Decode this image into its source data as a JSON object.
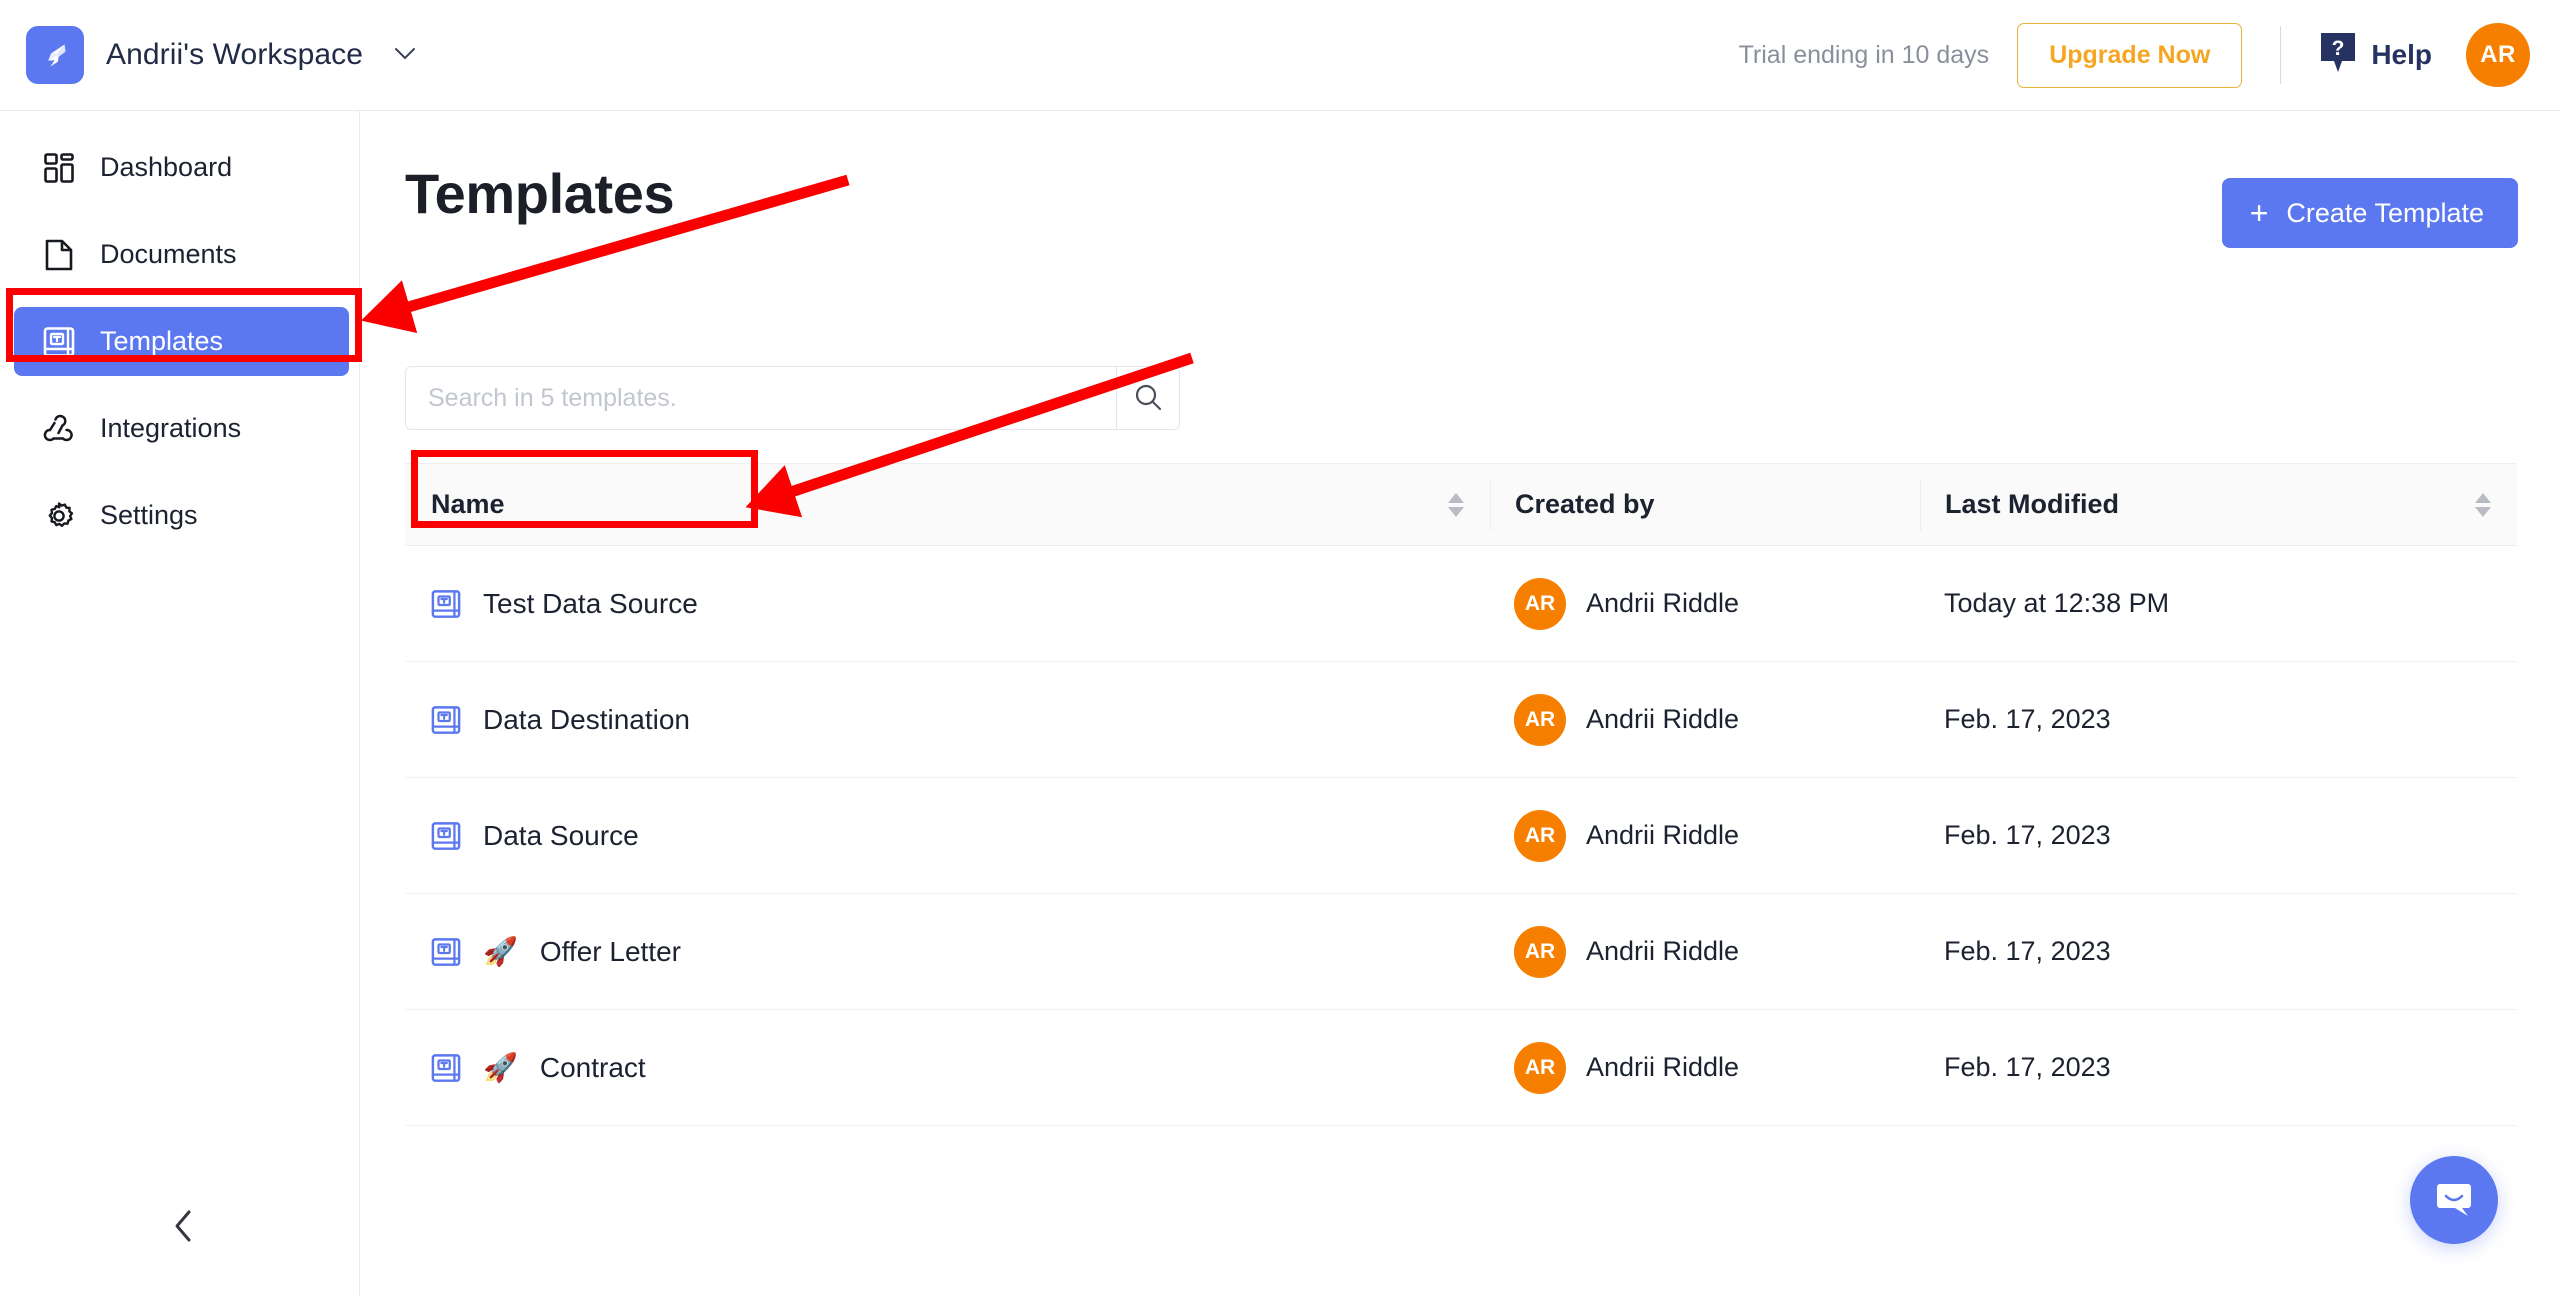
{
  "topbar": {
    "logo_icon": "bird-logo-icon",
    "workspace_name": "Andrii's Workspace",
    "workspace_caret": "⌄",
    "trial_text": "Trial ending in 10 days",
    "upgrade_label": "Upgrade Now",
    "help_icon": "help-question-bubble-icon",
    "help_label": "Help",
    "avatar_initials": "AR"
  },
  "sidebar": {
    "items": [
      {
        "label": "Dashboard",
        "icon": "dashboard-grid-icon",
        "active": false
      },
      {
        "label": "Documents",
        "icon": "document-page-icon",
        "active": false
      },
      {
        "label": "Templates",
        "icon": "template-book-icon",
        "active": true
      },
      {
        "label": "Integrations",
        "icon": "integrations-webhook-icon",
        "active": false
      },
      {
        "label": "Settings",
        "icon": "gear-icon",
        "active": false
      }
    ],
    "collapse_icon": "chevron-left-icon"
  },
  "main": {
    "page_title": "Templates",
    "create_button": {
      "plus": "+",
      "label": "Create Template"
    },
    "search": {
      "placeholder": "Search in 5 templates.",
      "value": "",
      "icon": "search-icon"
    },
    "table": {
      "headers": {
        "name": "Name",
        "created_by": "Created by",
        "last_modified": "Last Modified"
      },
      "rows": [
        {
          "icon": "template-book-icon",
          "emoji": "",
          "name": "Test Data Source",
          "author_initials": "AR",
          "author": "Andrii Riddle",
          "modified": "Today at 12:38 PM",
          "menu_icon": "kebab-menu-icon"
        },
        {
          "icon": "template-book-icon",
          "emoji": "",
          "name": "Data Destination",
          "author_initials": "AR",
          "author": "Andrii Riddle",
          "modified": "Feb. 17, 2023",
          "menu_icon": "kebab-menu-icon"
        },
        {
          "icon": "template-book-icon",
          "emoji": "",
          "name": "Data Source",
          "author_initials": "AR",
          "author": "Andrii Riddle",
          "modified": "Feb. 17, 2023",
          "menu_icon": "kebab-menu-icon"
        },
        {
          "icon": "template-book-icon",
          "emoji": "🚀",
          "name": "Offer Letter",
          "author_initials": "AR",
          "author": "Andrii Riddle",
          "modified": "Feb. 17, 2023",
          "menu_icon": "kebab-menu-icon"
        },
        {
          "icon": "template-book-icon",
          "emoji": "🚀",
          "name": "Contract",
          "author_initials": "AR",
          "author": "Andrii Riddle",
          "modified": "Feb. 17, 2023",
          "menu_icon": "kebab-menu-icon"
        }
      ]
    }
  },
  "chat_launcher": {
    "icon": "chat-bubble-smile-icon"
  },
  "annotations": {
    "color": "#fa0000",
    "boxes": [
      "templates-sidebar-item",
      "test-data-source-row-name"
    ],
    "arrows": [
      "arrow-to-templates-nav",
      "arrow-to-test-data-source"
    ]
  },
  "colors": {
    "accent_blue": "#5b78f0",
    "avatar_orange": "#f77f00",
    "upgrade_amber": "#f5a623",
    "help_navy": "#253262",
    "annotation_red": "#fa0000"
  }
}
